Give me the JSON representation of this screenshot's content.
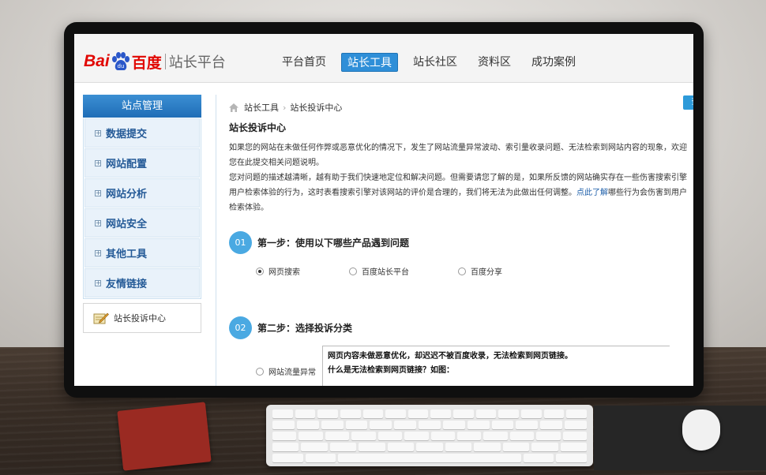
{
  "logo": {
    "brand_latin": "Bai",
    "brand_paw": "du",
    "brand_cn": "百度",
    "product": "站长平台"
  },
  "nav": {
    "items": [
      "平台首页",
      "站长工具",
      "站长社区",
      "资料区",
      "成功案例"
    ],
    "active_index": 1
  },
  "sidebar": {
    "title": "站点管理",
    "items": [
      "数据提交",
      "网站配置",
      "网站分析",
      "网站安全",
      "其他工具",
      "友情链接"
    ],
    "extra": "站长投诉中心"
  },
  "breadcrumb": {
    "root": "站长工具",
    "current": "站长投诉中心"
  },
  "my_complaints_button": "查看我的投诉",
  "page_title": "站长投诉中心",
  "intro_1": "如果您的网站在未做任何作弊或恶意优化的情况下，发生了网站流量异常波动、索引量收录问题、无法检索到网站内容的现象，欢迎您在此提交相关问题说明。",
  "intro_2_a": "您对问题的描述越清晰，越有助于我们快速地定位和解决问题。但需要请您了解的是，如果所反馈的网站确实存在一些伤害搜索引擎用户检索体验的行为，这时表看搜索引擎对该网站的评价是合理的，我们将无法为此做出任何调整。",
  "intro_2_link": "点此了解",
  "intro_2_b": "哪些行为会伤害到用户检索体验。",
  "step1": {
    "num": "01",
    "title": "第一步：使用以下哪些产品遇到问题",
    "options": [
      "网页搜索",
      "百度站长平台",
      "百度分享"
    ],
    "selected_index": 0
  },
  "step2": {
    "num": "02",
    "title": "第二步：选择投诉分类",
    "option": "网站流量异常",
    "detail_lines": [
      "网页内容未做恶意优化，却迟迟不被百度收录，无法检索到网页链接。",
      "什么是无法检索到网页链接？如图："
    ]
  },
  "colors": {
    "brand_red": "#e10601",
    "accent_blue": "#2f8fd8",
    "step_blue": "#4aa9e2"
  }
}
